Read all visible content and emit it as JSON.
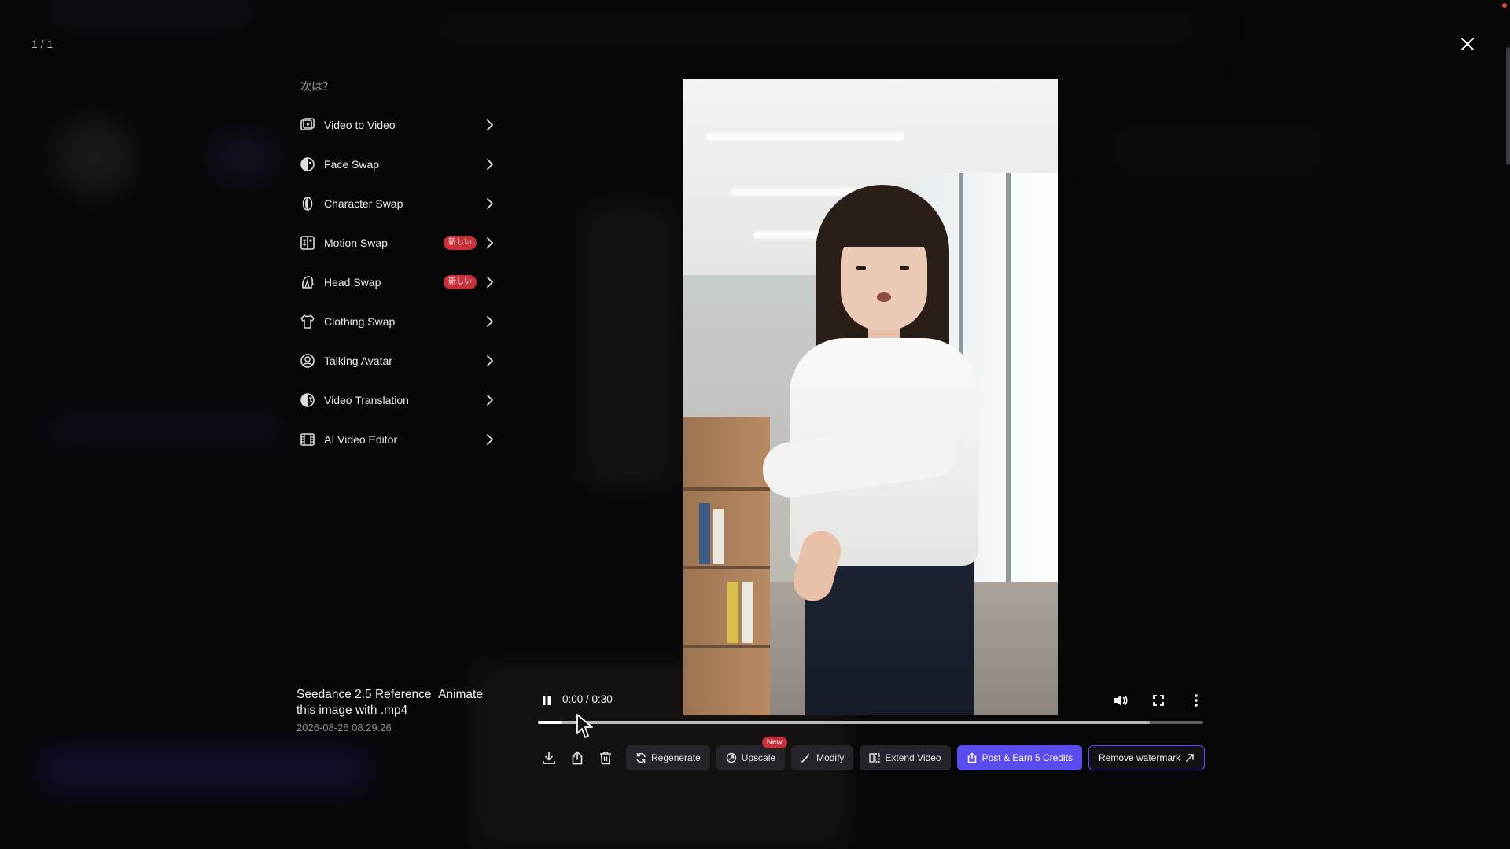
{
  "viewer": {
    "counter": "1 / 1",
    "close_icon": "close-icon"
  },
  "next_menu": {
    "title": "次は？",
    "items": [
      {
        "label": "Video to Video",
        "icon": "video-to-video-icon",
        "badge": ""
      },
      {
        "label": "Face Swap",
        "icon": "face-swap-icon",
        "badge": ""
      },
      {
        "label": "Character Swap",
        "icon": "character-swap-icon",
        "badge": ""
      },
      {
        "label": "Motion Swap",
        "icon": "motion-swap-icon",
        "badge": "新しい"
      },
      {
        "label": "Head Swap",
        "icon": "head-swap-icon",
        "badge": "新しい"
      },
      {
        "label": "Clothing Swap",
        "icon": "clothing-swap-icon",
        "badge": ""
      },
      {
        "label": "Talking Avatar",
        "icon": "talking-avatar-icon",
        "badge": ""
      },
      {
        "label": "Video Translation",
        "icon": "video-translation-icon",
        "badge": ""
      },
      {
        "label": "AI Video Editor",
        "icon": "ai-video-editor-icon",
        "badge": ""
      }
    ]
  },
  "video": {
    "title": "Seedance 2.5 Reference_Animate this image with .mp4",
    "date": "2026-08-26 08:29:26"
  },
  "player": {
    "time": "0:00 / 0:30",
    "progress": 0.035,
    "buffered": 0.92
  },
  "actions": {
    "regenerate": "Regenerate",
    "upscale": "Upscale",
    "upscale_badge": "New",
    "modify": "Modify",
    "extend": "Extend Video",
    "post": "Post & Earn 5 Credits",
    "remove_watermark": "Remove watermark"
  },
  "colors": {
    "accent": "#5b4cf0",
    "badge_red": "#c9303a",
    "background": "#08080a"
  }
}
